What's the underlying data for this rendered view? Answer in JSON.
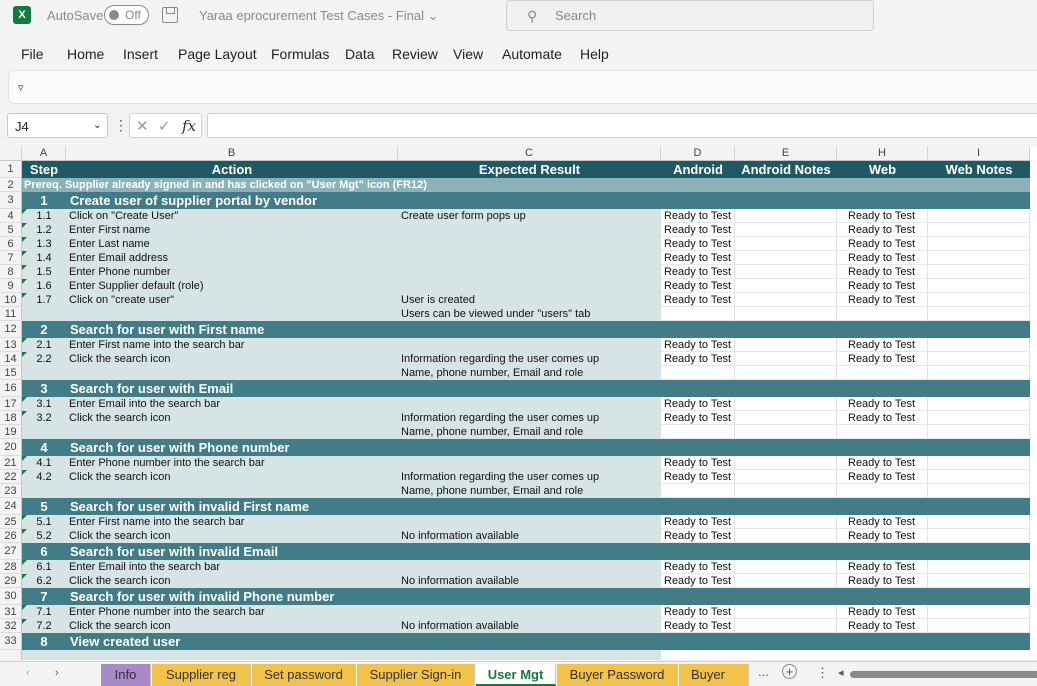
{
  "titlebar": {
    "logo": "X",
    "autosave_label": "AutoSave",
    "autosave_state": "Off",
    "document_title": "Yaraa eprocurement Test Cases - Final",
    "search_placeholder": "Search"
  },
  "menu": [
    "File",
    "Home",
    "Insert",
    "Page Layout",
    "Formulas",
    "Data",
    "Review",
    "View",
    "Automate",
    "Help"
  ],
  "ribbon": {
    "expand_glyph": "▿"
  },
  "formula_bar": {
    "name_box": "J4",
    "fx_label": "fx",
    "formula_value": ""
  },
  "columns": [
    {
      "label": "A",
      "w": 0
    },
    {
      "label": "B",
      "w": 0
    },
    {
      "label": "C",
      "w": 0
    },
    {
      "label": "D",
      "w": 0
    },
    {
      "label": "E",
      "w": 0
    },
    {
      "label": "H",
      "w": 0
    },
    {
      "label": "I",
      "w": 0
    }
  ],
  "headers": [
    "Step",
    "Action",
    "Expected Result",
    "Android",
    "Android Notes",
    "Web",
    "Web Notes"
  ],
  "prereq": "Prereq. Supplier already signed in and has clicked on \"User Mgt\" icon (FR12)",
  "rows": [
    {
      "n": "1",
      "type": "hdr"
    },
    {
      "n": "2",
      "type": "prereq"
    },
    {
      "n": "3",
      "type": "sec",
      "step": "1",
      "action": "Create user of supplier portal by vendor"
    },
    {
      "n": "4",
      "type": "step",
      "step": "1.1",
      "action": "Click on \"Create User\"",
      "expected": "Create user form pops up",
      "android": "Ready to Test",
      "web": "Ready to Test"
    },
    {
      "n": "5",
      "type": "step",
      "step": "1.2",
      "action": "Enter First name",
      "expected": "",
      "android": "Ready to Test",
      "web": "Ready to Test"
    },
    {
      "n": "6",
      "type": "step",
      "step": "1.3",
      "action": "Enter Last name",
      "expected": "",
      "android": "Ready to Test",
      "web": "Ready to Test"
    },
    {
      "n": "7",
      "type": "step",
      "step": "1.4",
      "action": "Enter Email address",
      "expected": "",
      "android": "Ready to Test",
      "web": "Ready to Test"
    },
    {
      "n": "8",
      "type": "step",
      "step": "1.5",
      "action": "Enter Phone number",
      "expected": "",
      "android": "Ready to Test",
      "web": "Ready to Test"
    },
    {
      "n": "9",
      "type": "step",
      "step": "1.6",
      "action": "Enter Supplier default (role)",
      "expected": "",
      "android": "Ready to Test",
      "web": "Ready to Test"
    },
    {
      "n": "10",
      "type": "step",
      "step": "1.7",
      "action": "Click on \"create user\"",
      "expected": "User is created",
      "android": "Ready to Test",
      "web": "Ready to Test"
    },
    {
      "n": "11",
      "type": "step",
      "step": "",
      "action": "",
      "expected": "Users can be viewed under \"users\" tab",
      "android": "",
      "web": ""
    },
    {
      "n": "12",
      "type": "sec",
      "step": "2",
      "action": "Search for user with First name"
    },
    {
      "n": "13",
      "type": "step",
      "step": "2.1",
      "action": "Enter First name into the search bar",
      "expected": "",
      "android": "Ready to Test",
      "web": "Ready to Test"
    },
    {
      "n": "14",
      "type": "step",
      "step": "2.2",
      "action": "Click the search icon",
      "expected": "Information regarding the user comes up",
      "android": "Ready to Test",
      "web": "Ready to Test"
    },
    {
      "n": "15",
      "type": "step",
      "step": "",
      "action": "",
      "expected": "Name, phone number, Email and role",
      "android": "",
      "web": ""
    },
    {
      "n": "16",
      "type": "sec",
      "step": "3",
      "action": "Search for user with Email"
    },
    {
      "n": "17",
      "type": "step",
      "step": "3.1",
      "action": "Enter Email into the search bar",
      "expected": "",
      "android": "Ready to Test",
      "web": "Ready to Test"
    },
    {
      "n": "18",
      "type": "step",
      "step": "3.2",
      "action": "Click the search icon",
      "expected": "Information regarding the user comes up",
      "android": "Ready to Test",
      "web": "Ready to Test"
    },
    {
      "n": "19",
      "type": "step",
      "step": "",
      "action": "",
      "expected": "Name, phone number, Email and role",
      "android": "",
      "web": ""
    },
    {
      "n": "20",
      "type": "sec",
      "step": "4",
      "action": "Search for user with Phone number"
    },
    {
      "n": "21",
      "type": "step",
      "step": "4.1",
      "action": "Enter Phone number into the search bar",
      "expected": "",
      "android": "Ready to Test",
      "web": "Ready to Test"
    },
    {
      "n": "22",
      "type": "step",
      "step": "4.2",
      "action": "Click the search icon",
      "expected": "Information regarding the user comes up",
      "android": "Ready to Test",
      "web": "Ready to Test"
    },
    {
      "n": "23",
      "type": "step",
      "step": "",
      "action": "",
      "expected": "Name, phone number, Email and role",
      "android": "",
      "web": ""
    },
    {
      "n": "24",
      "type": "sec",
      "step": "5",
      "action": "Search for user with invalid First name"
    },
    {
      "n": "25",
      "type": "step",
      "step": "5.1",
      "action": "Enter First name into the search bar",
      "expected": "",
      "android": "Ready to Test",
      "web": "Ready to Test"
    },
    {
      "n": "26",
      "type": "step",
      "step": "5.2",
      "action": "Click the search icon",
      "expected": "No information available",
      "android": "Ready to Test",
      "web": "Ready to Test"
    },
    {
      "n": "27",
      "type": "sec",
      "step": "6",
      "action": "Search for user with invalid Email"
    },
    {
      "n": "28",
      "type": "step",
      "step": "6.1",
      "action": "Enter Email into the search bar",
      "expected": "",
      "android": "Ready to Test",
      "web": "Ready to Test"
    },
    {
      "n": "29",
      "type": "step",
      "step": "6.2",
      "action": "Click the search icon",
      "expected": "No information available",
      "android": "Ready to Test",
      "web": "Ready to Test"
    },
    {
      "n": "30",
      "type": "sec",
      "step": "7",
      "action": "Search for user with invalid Phone number"
    },
    {
      "n": "31",
      "type": "step",
      "step": "7.1",
      "action": "Enter Phone number into the search bar",
      "expected": "",
      "android": "Ready to Test",
      "web": "Ready to Test"
    },
    {
      "n": "32",
      "type": "step",
      "step": "7.2",
      "action": "Click the search icon",
      "expected": "No information available",
      "android": "Ready to Test",
      "web": "Ready to Test"
    },
    {
      "n": "33",
      "type": "sec",
      "step": "8",
      "action": "View created user"
    }
  ],
  "sheet_tabs": [
    {
      "label": "Info",
      "color": "#a88ac8",
      "active": false
    },
    {
      "label": "Supplier reg",
      "color": "#f2c24a",
      "active": false
    },
    {
      "label": "Set password",
      "color": "#f2c24a",
      "active": false
    },
    {
      "label": "Supplier Sign-in",
      "color": "#f2c24a",
      "active": false
    },
    {
      "label": "User Mgt",
      "color": "#ffffff",
      "active": true
    },
    {
      "label": "Buyer Password",
      "color": "#f2c24a",
      "active": false
    },
    {
      "label": "Buyer Sign",
      "color": "#f2c24a",
      "active": false
    }
  ],
  "tabs_overflow": "...",
  "colors": {
    "header_bg": "#1f5a64",
    "section_bg": "#427c87",
    "prereq_bg": "#8ab2b8",
    "body_bg": "#d6e4e6",
    "excel_green": "#107c41"
  }
}
